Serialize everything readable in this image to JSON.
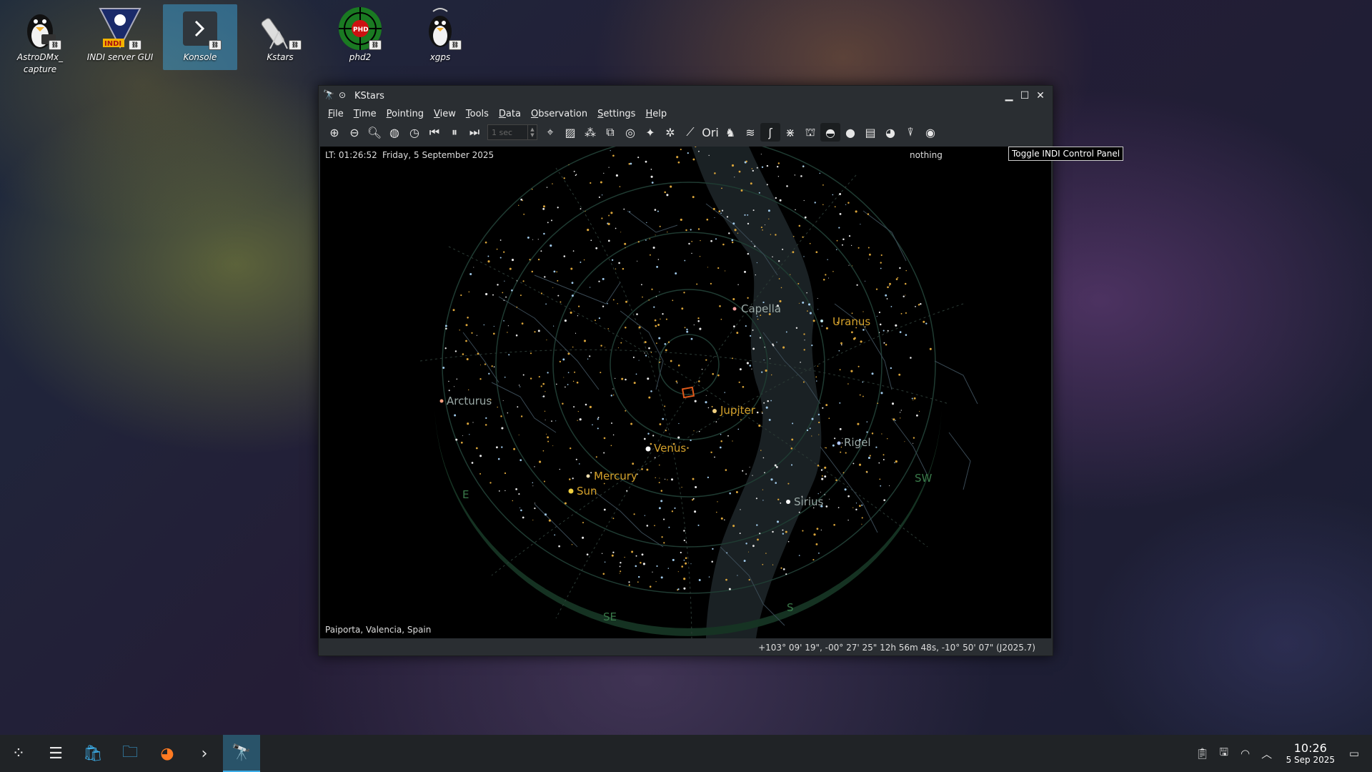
{
  "desktop": {
    "icons": [
      {
        "label_line1": "AstroDMx_",
        "label_line2": "capture",
        "glyph": "🐧"
      },
      {
        "label_line1": "INDI server GUI",
        "label_line2": "",
        "glyph": "◉",
        "badge": "INDI"
      },
      {
        "label_line1": "Konsole",
        "label_line2": "",
        "glyph": "›"
      },
      {
        "label_line1": "Kstars",
        "label_line2": "",
        "glyph": "🔭"
      },
      {
        "label_line1": "phd2",
        "label_line2": "",
        "glyph": "PHD"
      },
      {
        "label_line1": "xgps",
        "label_line2": "",
        "glyph": "🐧"
      }
    ]
  },
  "window": {
    "title": "KStars",
    "menu": [
      "File",
      "Time",
      "Pointing",
      "View",
      "Tools",
      "Data",
      "Observation",
      "Settings",
      "Help"
    ],
    "time_step": "1 sec",
    "sky": {
      "local_time": "LT: 01:26:52",
      "date": "Friday, 5 September 2025",
      "focus_object": "nothing",
      "location": "Paiporta, Valencia, Spain",
      "labels": {
        "capella": "Capella",
        "uranus": "Uranus",
        "arcturus": "Arcturus",
        "jupiter": "Jupiter",
        "venus": "Venus",
        "rigel": "Rigel",
        "mercury": "Mercury",
        "sun": "Sun",
        "sirius": "Sirius",
        "e": "E",
        "sw": "SW",
        "se": "SE",
        "s": "S"
      }
    },
    "status_coords": "+103° 09' 19\", -00° 27' 25\"  12h 56m 48s, -10° 50' 07\" (J2025.7)"
  },
  "tooltip": "Toggle INDI Control Panel",
  "taskbar": {
    "time": "10:26",
    "date": "5 Sep 2025"
  },
  "colors": {
    "accent": "#3daee9",
    "planet_label": "#d4a12a",
    "star_label": "#9aa9a6",
    "horizon": "#1f4a2e"
  }
}
